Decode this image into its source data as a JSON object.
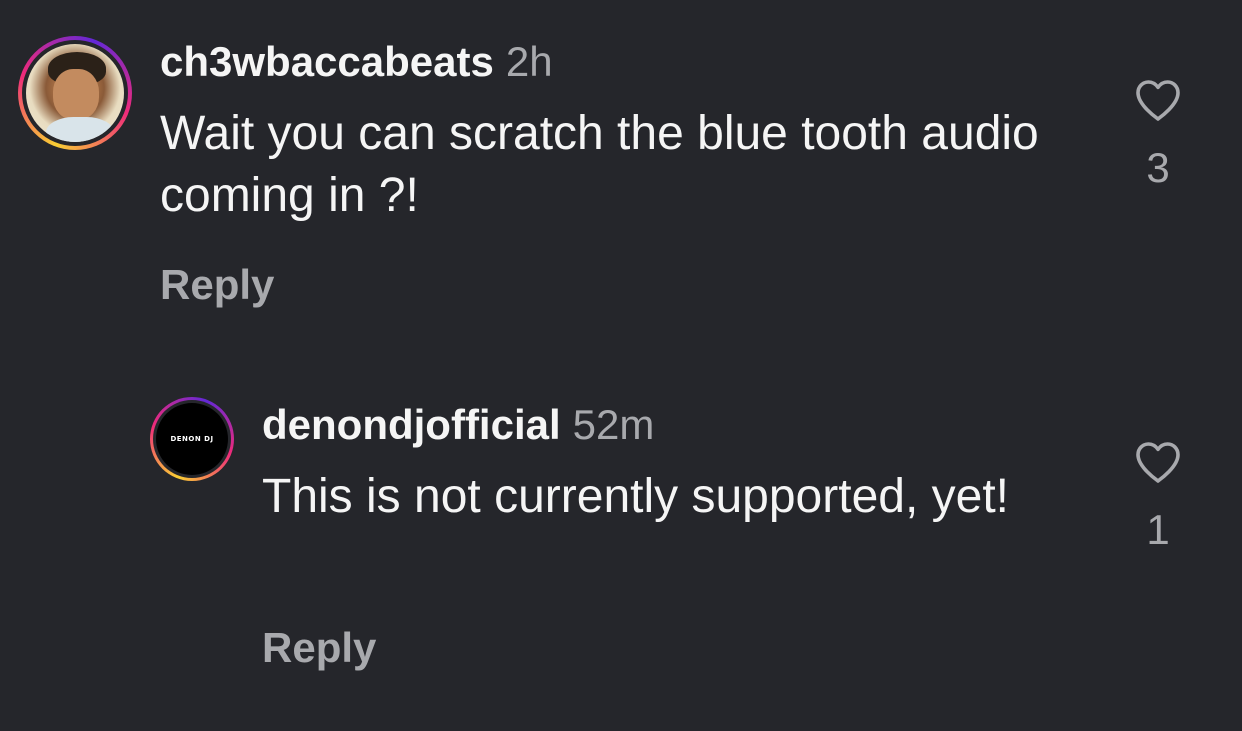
{
  "comments": [
    {
      "username": "ch3wbaccabeats",
      "time": "2h",
      "text": "Wait you can scratch the blue tooth audio coming in ?!",
      "reply_label": "Reply",
      "like_count": "3",
      "avatar_icon": "user-photo"
    },
    {
      "username": "denondjofficial",
      "time": "52m",
      "text": "This is not currently supported, yet!",
      "reply_label": "Reply",
      "like_count": "1",
      "avatar_icon": "denon-dj-logo",
      "avatar_logo_text": "DENON DJ"
    }
  ],
  "colors": {
    "background": "#25262b",
    "primary_text": "#f5f5f5",
    "secondary_text": "#a8a9ad"
  }
}
